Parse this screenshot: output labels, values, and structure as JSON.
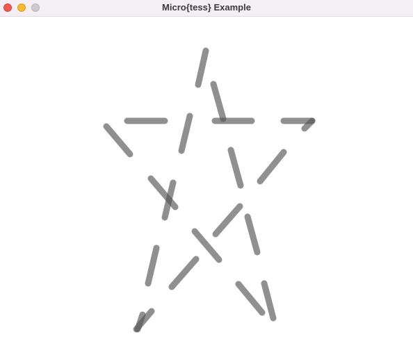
{
  "window": {
    "title": "Micro{tess} Example"
  },
  "colors": {
    "titlebar": "#f4eef5",
    "close": "#ee5a52",
    "minimize": "#f5b82e",
    "zoom": "#cfcacf",
    "stroke": "#555555",
    "background": "#ffffff"
  }
}
